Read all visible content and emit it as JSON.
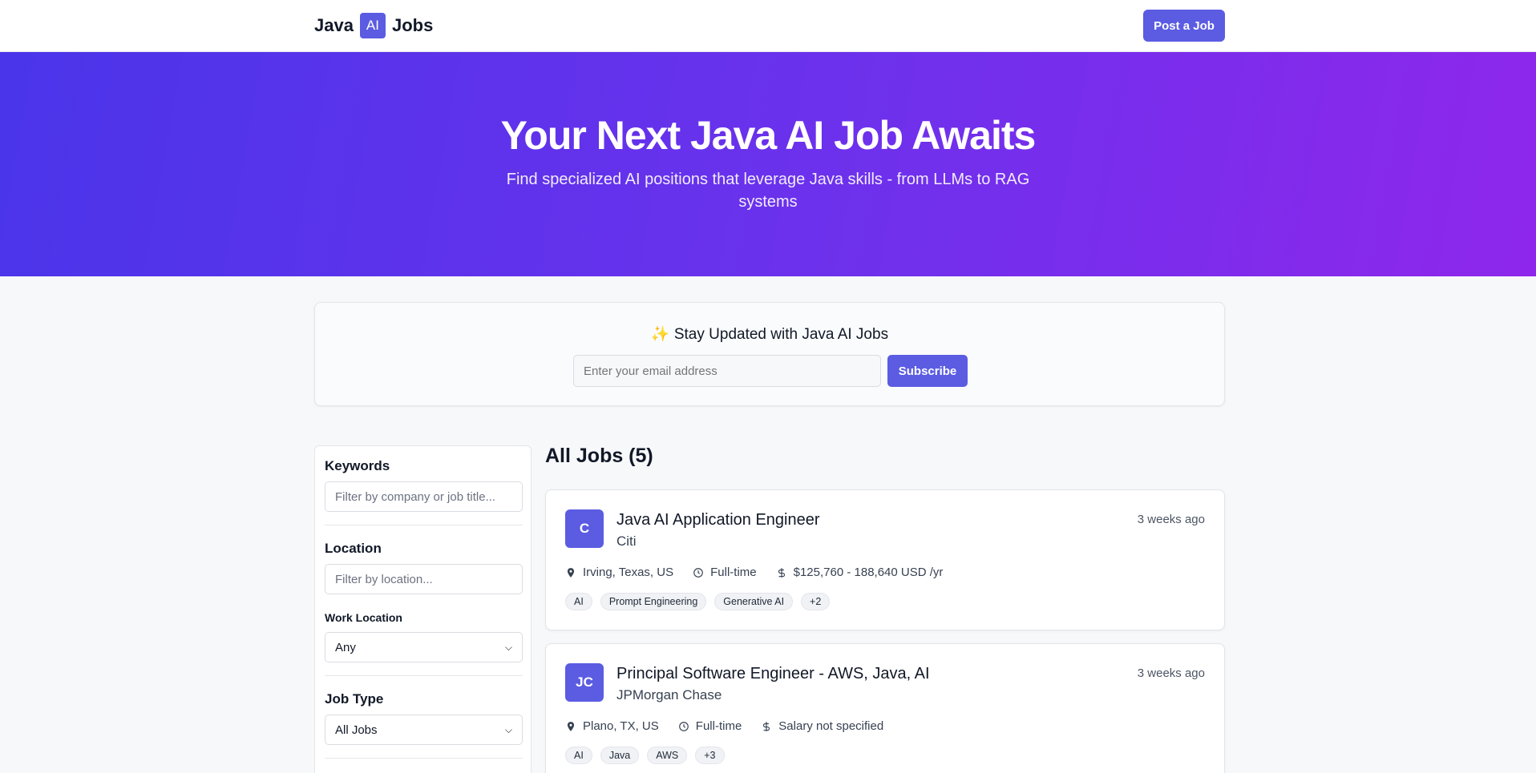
{
  "header": {
    "logo_left": "Java",
    "logo_badge": "AI",
    "logo_right": "Jobs",
    "post_job_label": "Post a Job"
  },
  "hero": {
    "title": "Your Next Java AI Job Awaits",
    "subtitle": "Find specialized AI positions that leverage Java skills - from LLMs to RAG systems"
  },
  "newsletter": {
    "heading": "✨ Stay Updated with Java AI Jobs",
    "email_placeholder": "Enter your email address",
    "subscribe_label": "Subscribe"
  },
  "filters": {
    "keywords_label": "Keywords",
    "keywords_placeholder": "Filter by company or job title...",
    "location_label": "Location",
    "location_placeholder": "Filter by location...",
    "work_location_label": "Work Location",
    "work_location_value": "Any",
    "job_type_label": "Job Type",
    "job_type_value": "All Jobs"
  },
  "jobs": {
    "heading": "All Jobs (5)",
    "items": [
      {
        "initials": "C",
        "title": "Java AI Application Engineer",
        "company": "Citi",
        "posted": "3 weeks ago",
        "location": "Irving, Texas, US",
        "type": "Full-time",
        "salary": "$125,760 - 188,640 USD /yr",
        "tags": [
          "AI",
          "Prompt Engineering",
          "Generative AI",
          "+2"
        ]
      },
      {
        "initials": "JC",
        "title": "Principal Software Engineer - AWS, Java, AI",
        "company": "JPMorgan Chase",
        "posted": "3 weeks ago",
        "location": "Plano, TX, US",
        "type": "Full-time",
        "salary": "Salary not specified",
        "tags": [
          "AI",
          "Java",
          "AWS",
          "+3"
        ]
      }
    ]
  },
  "colors": {
    "accent": "#5b5ce2",
    "hero_gradient_start": "#4a35ea",
    "hero_gradient_end": "#8e27eb"
  }
}
